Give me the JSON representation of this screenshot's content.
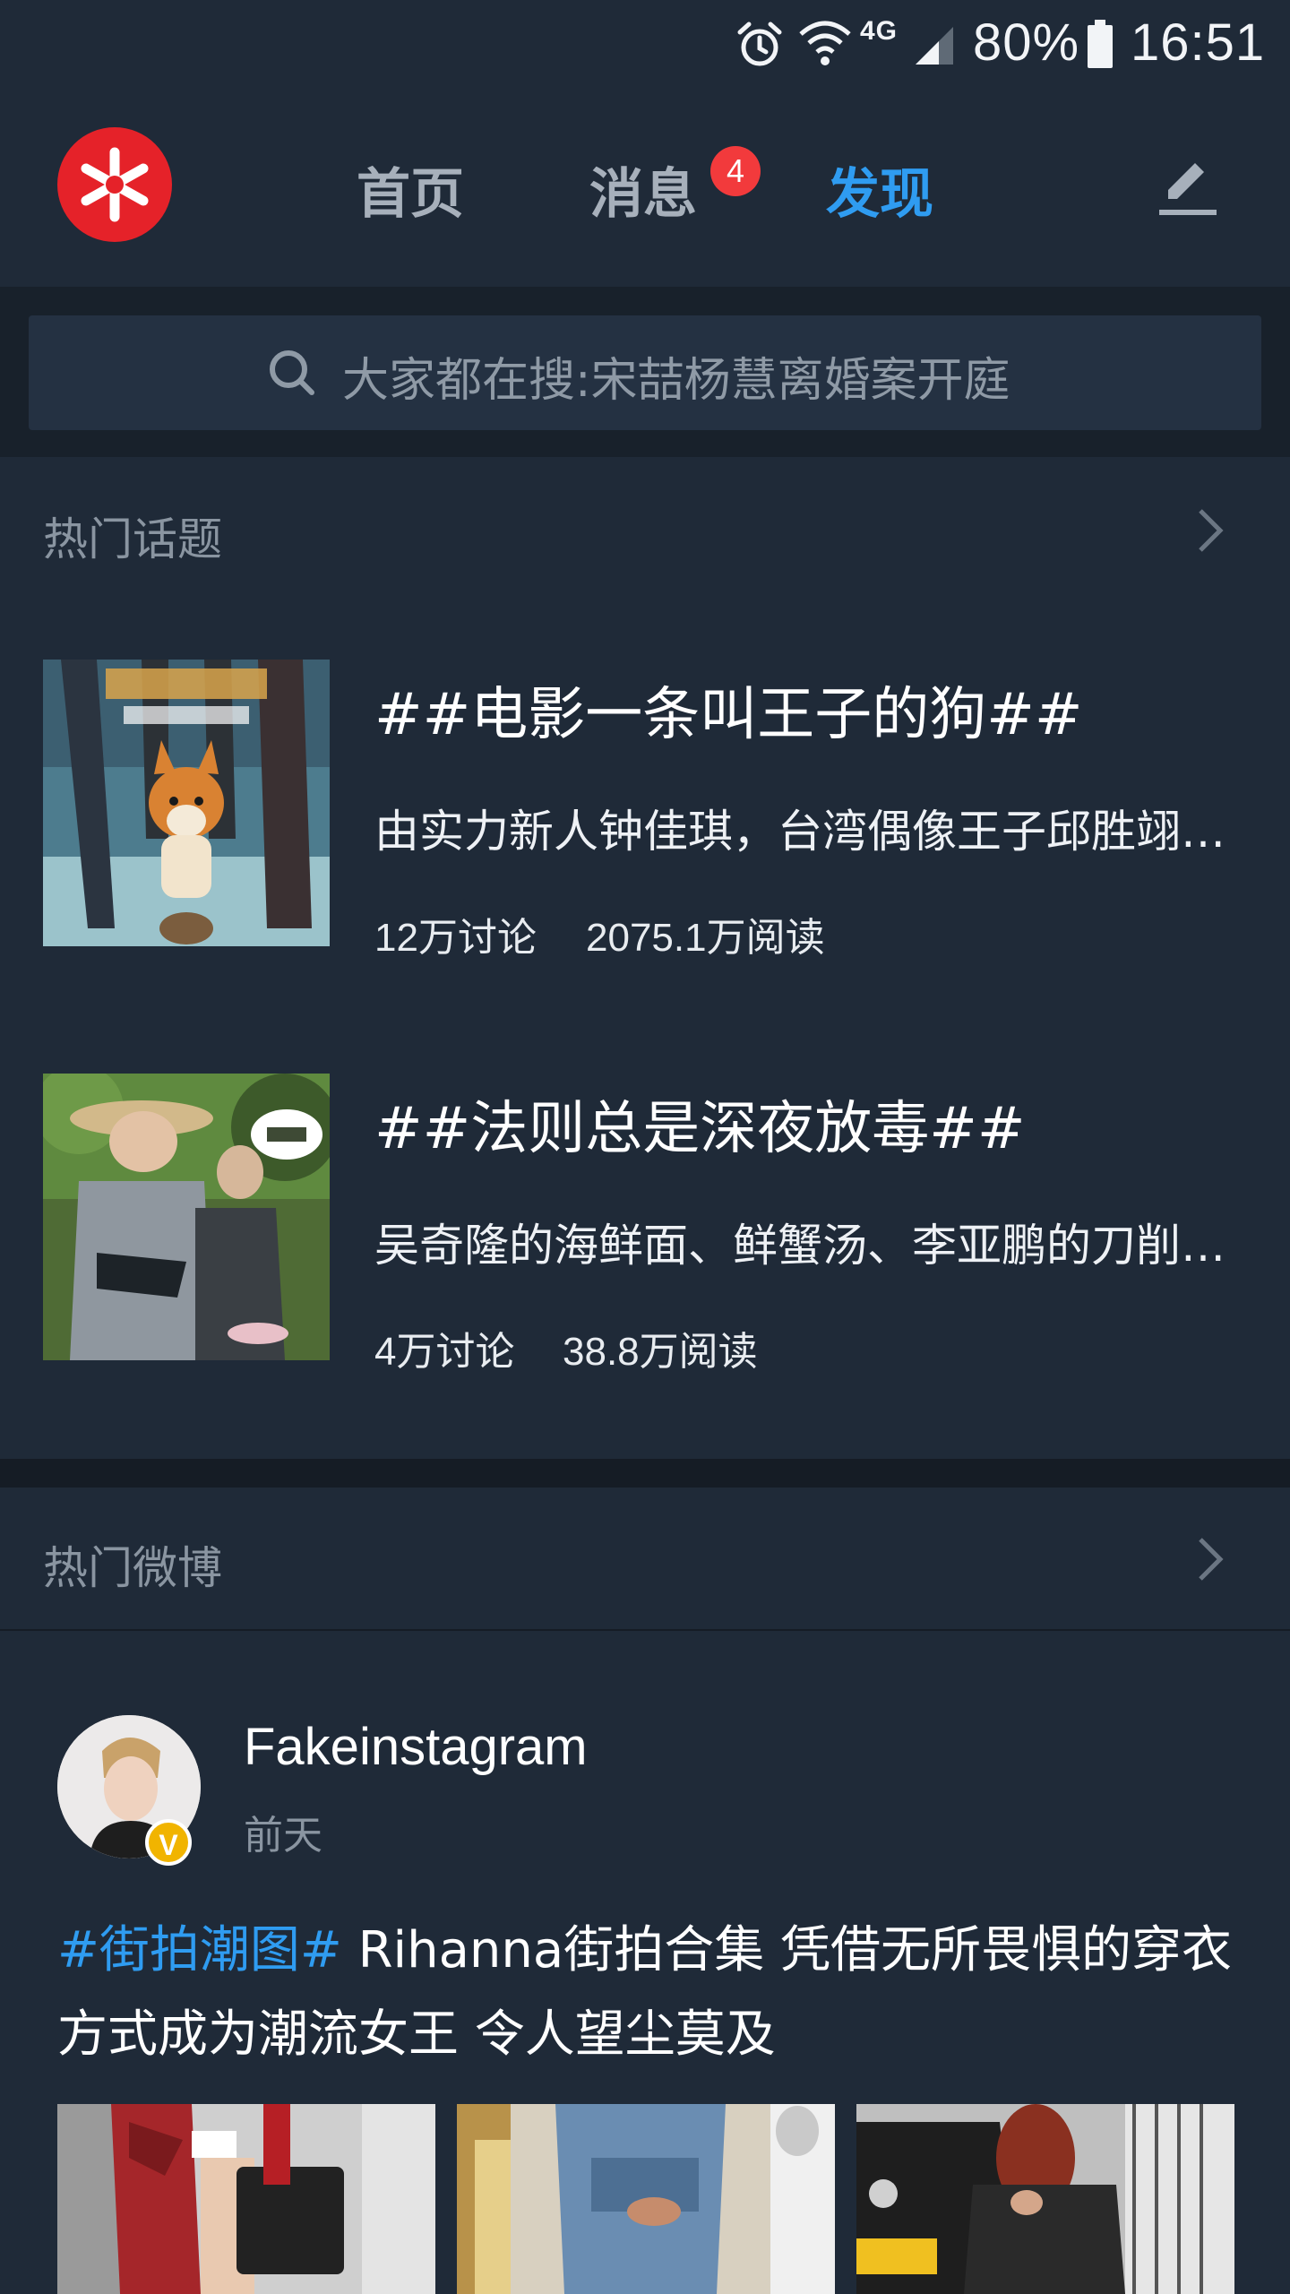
{
  "status_bar": {
    "battery": "80%",
    "time": "16:51",
    "network": "4G"
  },
  "nav": {
    "logo_icon": "weibo-logo",
    "tabs": [
      {
        "label": "首页"
      },
      {
        "label": "消息",
        "badge": "4"
      },
      {
        "label": "发现",
        "active": true
      }
    ],
    "compose_icon": "edit-pencil-icon",
    "accent_color": "#2f9cf1"
  },
  "search": {
    "placeholder": "大家都在搜:宋喆杨慧离婚案开庭"
  },
  "hot_topics": {
    "title": "热门话题",
    "items": [
      {
        "title": "##电影一条叫王子的狗##",
        "description": "由实力新人钟佳琪，台湾偶像王子邱胜翊…",
        "discussions": "12万讨论",
        "reads": "2075.1万阅读"
      },
      {
        "title": "##法则总是深夜放毒##",
        "description": "吴奇隆的海鲜面、鲜蟹汤、李亚鹏的刀削…",
        "discussions": "4万讨论",
        "reads": "38.8万阅读"
      }
    ]
  },
  "hot_weibo": {
    "title": "热门微博",
    "post": {
      "username": "Fakeinstagram",
      "time": "前天",
      "verified_badge": "V",
      "hashtag": "#街拍潮图#",
      "text": " Rihanna街拍合集 凭借无所畏惧的穿衣方式成为潮流女王 令人望尘莫及"
    }
  }
}
